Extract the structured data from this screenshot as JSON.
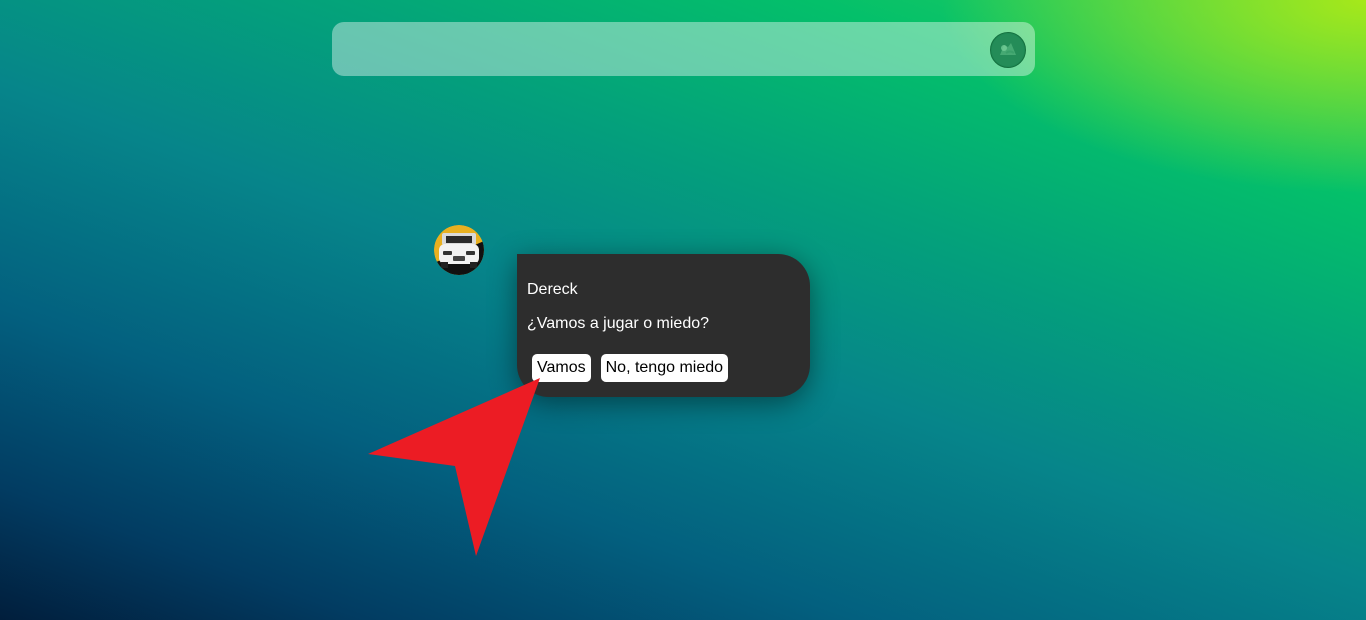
{
  "theme": {
    "bubble_bg": "#2d2d2d",
    "button_bg": "#ffffff",
    "pointer_color": "#ec1c24",
    "avatar_bg": "#e8b020"
  },
  "search_bar": {
    "profile_icon": "avatar-icon"
  },
  "chat": {
    "avatar_icon": "car-avatar-icon",
    "sender": "Dereck",
    "message": "¿Vamos a jugar o miedo?",
    "buttons": {
      "accept_label": "Vamos",
      "decline_label": "No, tengo miedo"
    }
  },
  "annotation": {
    "icon": "red-arrow-pointer-icon"
  }
}
